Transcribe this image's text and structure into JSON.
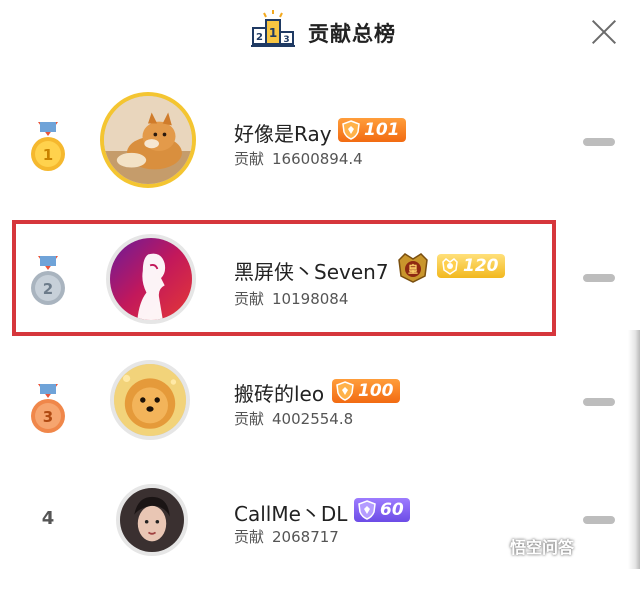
{
  "header": {
    "title": "贡献总榜",
    "podium_digits": [
      "2",
      "1",
      "3"
    ]
  },
  "contribution_label": "贡献",
  "rows": [
    {
      "rank": "1",
      "medal": "gold",
      "name": "好像是Ray",
      "badge": {
        "level": "101",
        "color": "orange",
        "icon": "shield-icon"
      },
      "contribution": "16600894.4",
      "avatar": "shiba-dog"
    },
    {
      "rank": "2",
      "medal": "silver",
      "name": "黑屏侠丶Seven7",
      "crown_badge": {
        "text": "皇",
        "icon": "crown-emblem-icon"
      },
      "badge": {
        "level": "120",
        "color": "gold",
        "icon": "crown-shield-icon"
      },
      "contribution": "10198084",
      "avatar": "red-silhouette",
      "highlighted": true
    },
    {
      "rank": "3",
      "medal": "bronze",
      "name": "搬砖的leo",
      "badge": {
        "level": "100",
        "color": "orange",
        "icon": "shield-icon"
      },
      "contribution": "4002554.8",
      "avatar": "pomeranian"
    },
    {
      "rank": "4",
      "medal": "none",
      "name": "CallMe丶DL",
      "badge": {
        "level": "60",
        "color": "purple",
        "icon": "shield-icon"
      },
      "contribution": "2068717",
      "avatar": "woman-portrait"
    }
  ],
  "watermark": {
    "text": "悟空问答"
  },
  "colors": {
    "orange_badge": "#f26b12",
    "gold_badge": "#f2b81f",
    "purple_badge": "#6c4ce6",
    "highlight_border": "#d6363c",
    "gold_ring": "#f4c531"
  }
}
